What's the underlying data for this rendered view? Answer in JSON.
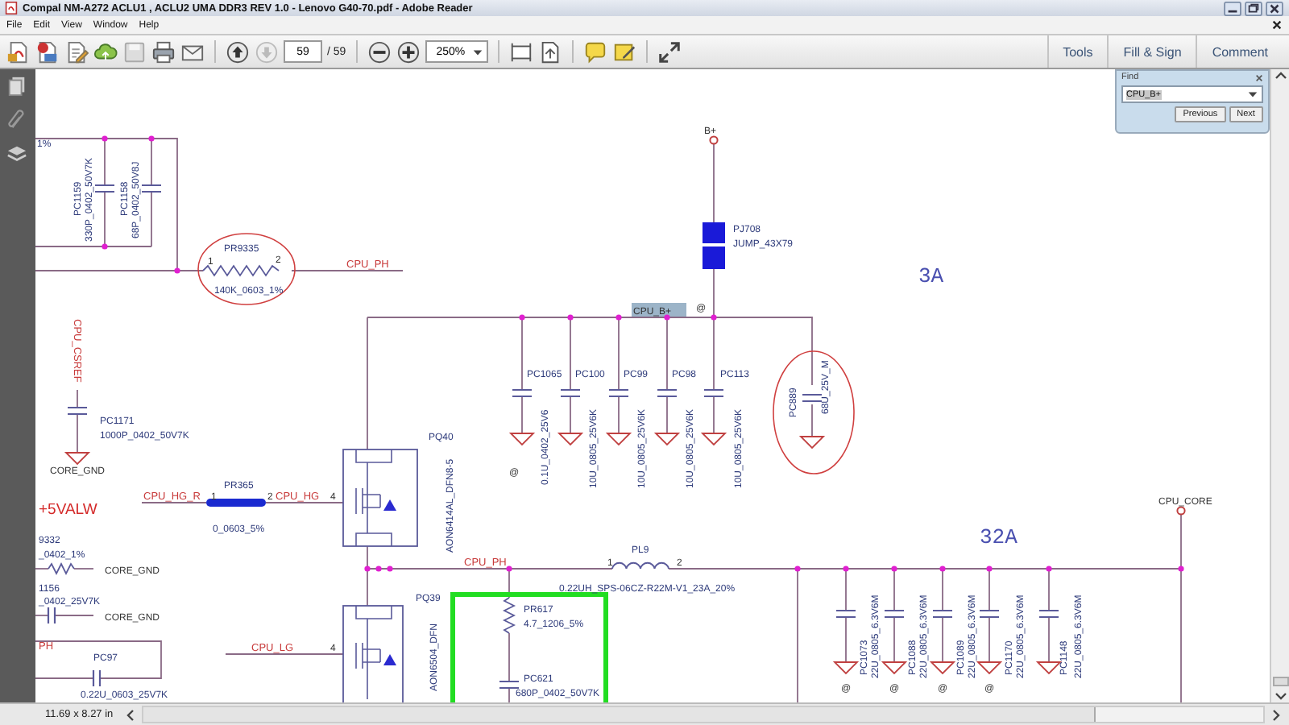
{
  "window": {
    "title": "Compal NM-A272 ACLU1 , ACLU2 UMA DDR3 REV 1.0 - Lenovo G40-70.pdf - Adobe Reader"
  },
  "menu": [
    "File",
    "Edit",
    "View",
    "Window",
    "Help"
  ],
  "toolbar": {
    "page": "59",
    "page_total": "/ 59",
    "zoom": "250%",
    "panels": [
      "Tools",
      "Fill & Sign",
      "Comment"
    ]
  },
  "find": {
    "title": "Find",
    "query": "CPU_B+",
    "buttons": [
      "Previous",
      "Next"
    ]
  },
  "schematic": {
    "labels": [
      {
        "text": "1%",
        "kind": "value"
      },
      {
        "text": "PC1159",
        "kind": "part"
      },
      {
        "text": "330P_0402_50V7K",
        "kind": "value"
      },
      {
        "text": "PC1158",
        "kind": "part"
      },
      {
        "text": "68P_0402_50V8J",
        "kind": "value"
      },
      {
        "text": "PR9335",
        "kind": "part"
      },
      {
        "text": "1",
        "kind": "pin"
      },
      {
        "text": "2",
        "kind": "pin"
      },
      {
        "text": "140K_0603_1%",
        "kind": "value"
      },
      {
        "text": "CPU_PH",
        "kind": "net"
      },
      {
        "text": "CPU_CSREF",
        "kind": "net"
      },
      {
        "text": "PC1171",
        "kind": "part"
      },
      {
        "text": "1000P_0402_50V7K",
        "kind": "value"
      },
      {
        "text": "CORE_GND",
        "kind": "power"
      },
      {
        "text": "+5VALW",
        "kind": "rail"
      },
      {
        "text": "CPU_HG_R",
        "kind": "net"
      },
      {
        "text": "PR365",
        "kind": "part"
      },
      {
        "text": "1",
        "kind": "pin"
      },
      {
        "text": "2",
        "kind": "pin"
      },
      {
        "text": "CPU_HG",
        "kind": "net"
      },
      {
        "text": "4",
        "kind": "pin"
      },
      {
        "text": "0_0603_5%",
        "kind": "value"
      },
      {
        "text": "9332",
        "kind": "part"
      },
      {
        "text": "_0402_1%",
        "kind": "value"
      },
      {
        "text": "CORE_GND",
        "kind": "power"
      },
      {
        "text": "1156",
        "kind": "part"
      },
      {
        "text": "_0402_25V7K",
        "kind": "value"
      },
      {
        "text": "CORE_GND",
        "kind": "power"
      },
      {
        "text": "PH",
        "kind": "net"
      },
      {
        "text": "PC97",
        "kind": "part"
      },
      {
        "text": "0.22U_0603_25V7K",
        "kind": "value"
      },
      {
        "text": "CPU_LG",
        "kind": "net"
      },
      {
        "text": "4",
        "kind": "pin"
      },
      {
        "text": "PQ40",
        "kind": "part"
      },
      {
        "text": "AON6414AL_DFN8-5",
        "kind": "value"
      },
      {
        "text": "PQ39",
        "kind": "part"
      },
      {
        "text": "AON6504_DFN",
        "kind": "value"
      },
      {
        "text": "CPU_PH",
        "kind": "net"
      },
      {
        "text": "PL9",
        "kind": "part"
      },
      {
        "text": "1",
        "kind": "pin"
      },
      {
        "text": "2",
        "kind": "pin"
      },
      {
        "text": "0.22UH_SPS-06CZ-R22M-V1_23A_20%",
        "kind": "value"
      },
      {
        "text": "PR617",
        "kind": "part"
      },
      {
        "text": "4.7_1206_5%",
        "kind": "value"
      },
      {
        "text": "PC621",
        "kind": "part"
      },
      {
        "text": "680P_0402_50V7K",
        "kind": "value"
      },
      {
        "text": "B+",
        "kind": "power"
      },
      {
        "text": "PJ708",
        "kind": "part"
      },
      {
        "text": "JUMP_43X79",
        "kind": "value"
      },
      {
        "text": "3A",
        "kind": "current"
      },
      {
        "text": "CPU_B+",
        "kind": "found"
      },
      {
        "text": "PC1065",
        "kind": "part"
      },
      {
        "text": "PC100",
        "kind": "part"
      },
      {
        "text": "PC99",
        "kind": "part"
      },
      {
        "text": "PC98",
        "kind": "part"
      },
      {
        "text": "PC113",
        "kind": "part"
      },
      {
        "text": "0.1U_0402_25V6",
        "kind": "value"
      },
      {
        "text": "10U_0805_25V6K",
        "kind": "value"
      },
      {
        "text": "10U_0805_25V6K",
        "kind": "value"
      },
      {
        "text": "10U_0805_25V6K",
        "kind": "value"
      },
      {
        "text": "10U_0805_25V6K",
        "kind": "value"
      },
      {
        "text": "PC889",
        "kind": "part"
      },
      {
        "text": "68U_25V_M",
        "kind": "value"
      },
      {
        "text": "32A",
        "kind": "current"
      },
      {
        "text": "CPU_CORE",
        "kind": "power"
      },
      {
        "text": "PC1073",
        "kind": "part"
      },
      {
        "text": "22U_0805_6.3V6M",
        "kind": "value"
      },
      {
        "text": "PC1088",
        "kind": "part"
      },
      {
        "text": "22U_0805_6.3V6M",
        "kind": "value"
      },
      {
        "text": "PC1089",
        "kind": "part"
      },
      {
        "text": "22U_0805_6.3V6M",
        "kind": "value"
      },
      {
        "text": "PC1170",
        "kind": "part"
      },
      {
        "text": "22U_0805_6.3V6M",
        "kind": "value"
      },
      {
        "text": "PC1148",
        "kind": "part"
      },
      {
        "text": "22U_0805_6.3V6M",
        "kind": "value"
      },
      {
        "text": "@",
        "kind": "mark"
      },
      {
        "text": "@",
        "kind": "mark"
      },
      {
        "text": "@",
        "kind": "mark"
      },
      {
        "text": "@",
        "kind": "mark"
      },
      {
        "text": "@",
        "kind": "mark"
      },
      {
        "text": "@",
        "kind": "mark"
      }
    ]
  },
  "status_bar": {
    "page_size": "11.69 x 8.27 in"
  }
}
